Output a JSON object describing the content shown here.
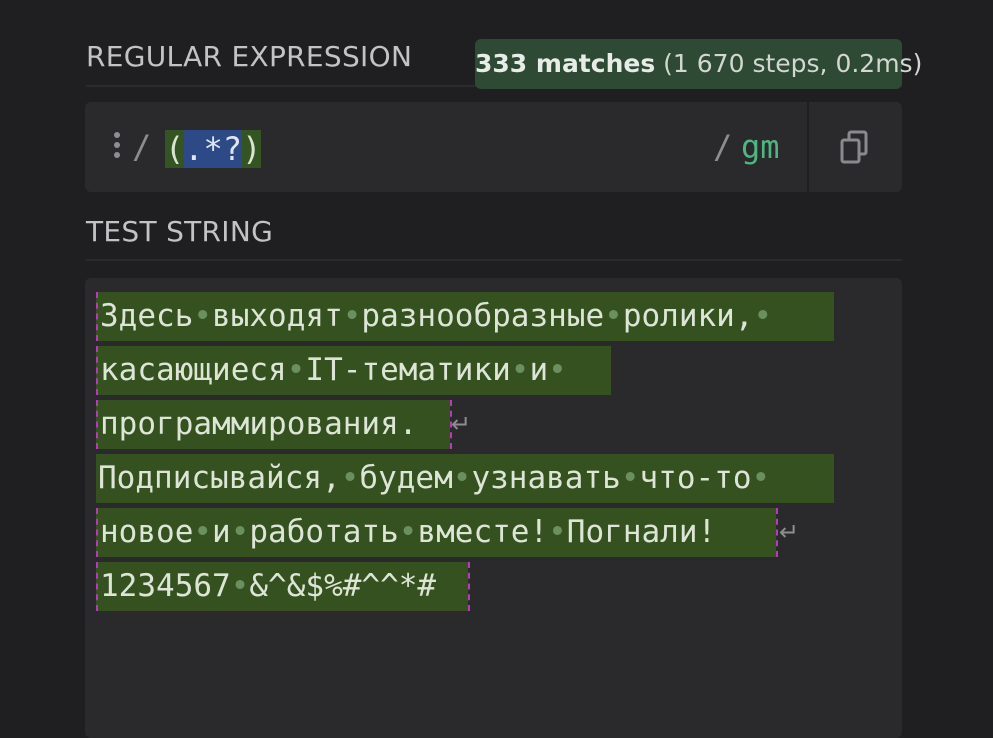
{
  "regex_section": {
    "title": "REGULAR EXPRESSION",
    "match_count": "333 matches",
    "match_steps": "(1 670 steps, 0.2ms)",
    "open_delimiter": "/",
    "expression_open": "(",
    "expression_inner": ".*?",
    "expression_close": ")",
    "close_delimiter": "/",
    "flags": "gm",
    "menu_icon": "kebab-menu-icon",
    "copy_icon": "copy-icon"
  },
  "test_section": {
    "title": "TEST STRING",
    "lines": [
      "Здесь•выходят•разнообразные•ролики,•",
      "касающиеся•IT-тематики•и•",
      "программирования.",
      "Подписывайся,•будем•узнавать•что-то•",
      "новое•и•работать•вместе!•Погнали!",
      "1234567•&^&$%#^^*#"
    ]
  },
  "colors": {
    "background": "#1f1f21",
    "panel": "#2a2a2d",
    "match_highlight": "#35511f",
    "group_highlight": "#2d4a86",
    "badge": "#2e4a35",
    "flags": "#4eb583",
    "match_border": "#b63bb8"
  }
}
